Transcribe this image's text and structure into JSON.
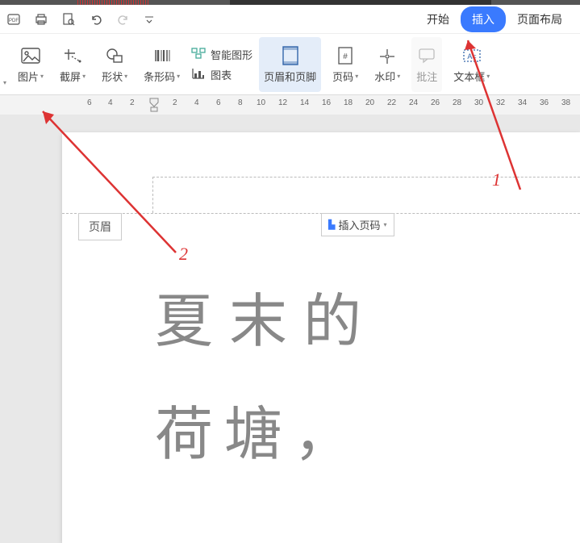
{
  "tabs": {
    "start": "开始",
    "insert": "插入",
    "layout": "页面布局"
  },
  "ribbon": {
    "picture": "图片",
    "screenshot": "截屏",
    "shape": "形状",
    "barcode": "条形码",
    "smartart": "智能图形",
    "chart": "图表",
    "header_footer": "页眉和页脚",
    "page_number": "页码",
    "watermark": "水印",
    "comment": "批注",
    "textbox": "文本框"
  },
  "ruler": {
    "ticks": [
      "6",
      "4",
      "2",
      "2",
      "4",
      "6",
      "8",
      "10",
      "12",
      "14",
      "16",
      "18",
      "20",
      "22",
      "24",
      "26",
      "28",
      "30",
      "32",
      "34",
      "36",
      "38"
    ]
  },
  "header_tag": "页眉",
  "insert_page_num": "插入页码",
  "body_line1": "夏末的",
  "body_line2": "荷塘，",
  "annotations": {
    "num1": "1",
    "num2": "2"
  }
}
